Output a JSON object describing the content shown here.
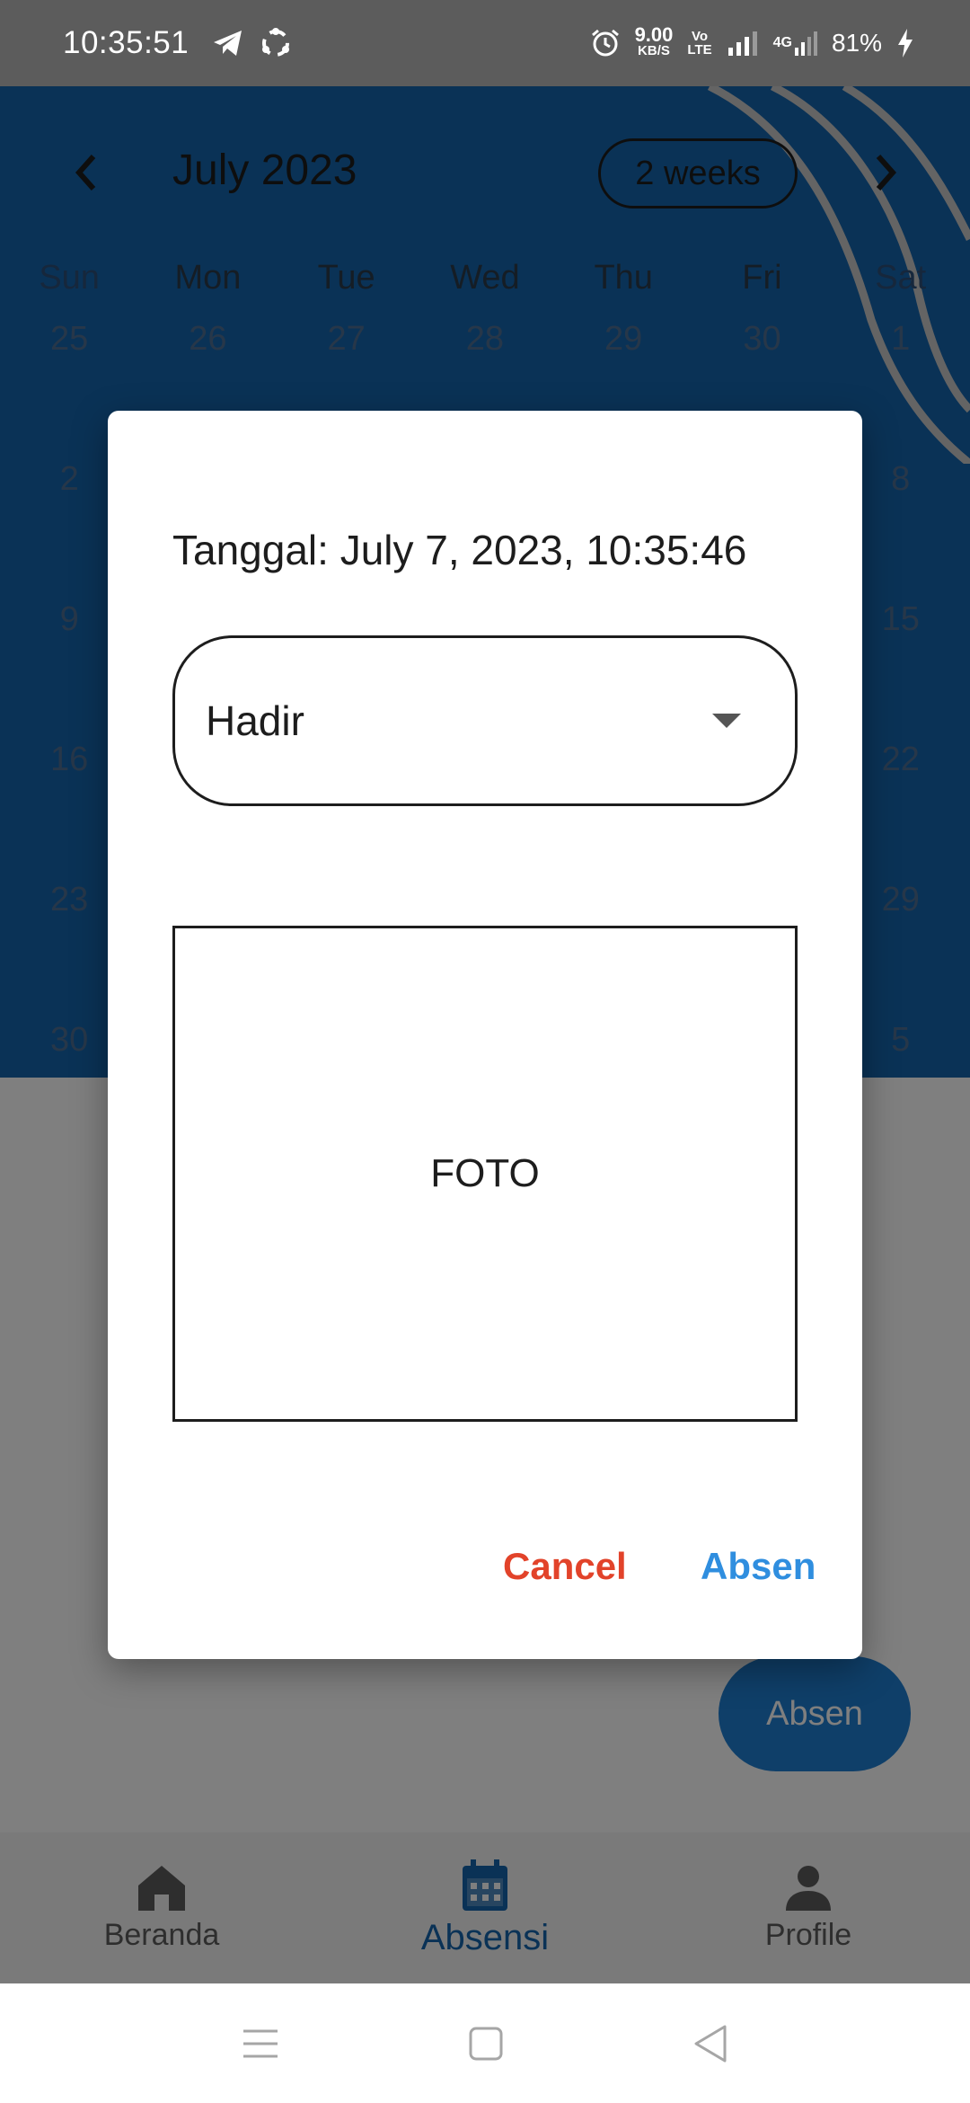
{
  "status_bar": {
    "time": "10:35:51",
    "speed_value": "9.00",
    "speed_unit": "KB/S",
    "volte_top": "Vo",
    "volte_bottom": "LTE",
    "network_type": "4G",
    "battery": "81%",
    "icons": [
      "telegram-icon",
      "sync-icon",
      "alarm-icon",
      "signal-icon",
      "battery-charging-icon"
    ]
  },
  "calendar": {
    "month_title": "July 2023",
    "format_button": "2 weeks",
    "weekdays": [
      "Sun",
      "Mon",
      "Tue",
      "Wed",
      "Thu",
      "Fri",
      "Sat"
    ],
    "rows": [
      [
        "25",
        "26",
        "27",
        "28",
        "29",
        "30",
        "1"
      ],
      [
        "2",
        "",
        "",
        "",
        "",
        "",
        "8"
      ],
      [
        "9",
        "",
        "",
        "",
        "",
        "",
        "15"
      ],
      [
        "16",
        "",
        "",
        "",
        "",
        "",
        "22"
      ],
      [
        "23",
        "",
        "",
        "",
        "",
        "",
        "29"
      ],
      [
        "30",
        "",
        "",
        "",
        "",
        "",
        "5"
      ]
    ]
  },
  "fab": {
    "label": "Absen"
  },
  "bottom_nav": {
    "items": [
      {
        "label": "Beranda",
        "icon": "home-icon"
      },
      {
        "label": "Absensi",
        "icon": "calendar-icon"
      },
      {
        "label": "Profile",
        "icon": "person-icon"
      }
    ],
    "active_index": 1
  },
  "dialog": {
    "date_label": "Tanggal: July 7, 2023, 10:35:46",
    "status_select": {
      "value": "Hadir"
    },
    "photo_label": "FOTO",
    "cancel_label": "Cancel",
    "submit_label": "Absen"
  },
  "colors": {
    "calendar_blue": "#1565ad",
    "cancel_red": "#e2432a",
    "submit_blue": "#2f8edf",
    "fab_blue": "#1f7fd2"
  }
}
